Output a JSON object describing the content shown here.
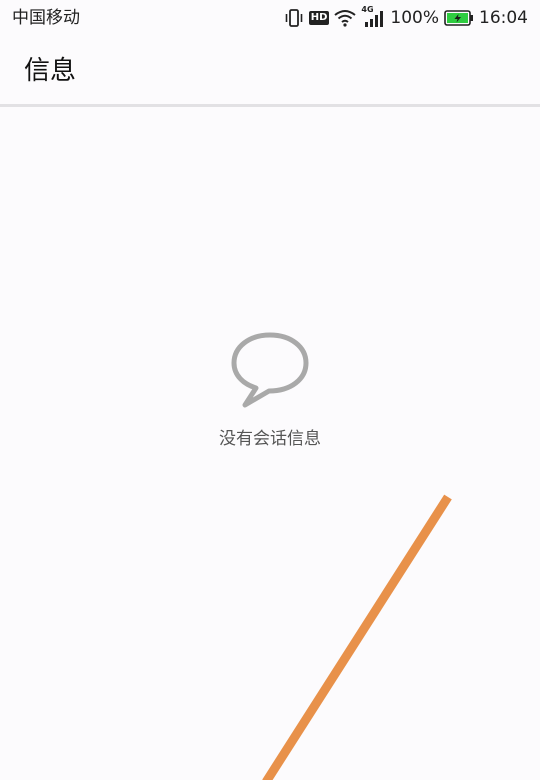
{
  "status_bar": {
    "carrier": "中国移动",
    "hd_label": "HD",
    "network_label": "4G",
    "battery_percent": "100%",
    "time": "16:04",
    "icons": [
      "vibrate-icon",
      "hd-icon",
      "wifi-icon",
      "signal-4g-icon",
      "battery-charging-icon"
    ],
    "battery_color": "#2ecc40"
  },
  "header": {
    "title": "信息"
  },
  "empty_state": {
    "icon": "chat-bubble-icon",
    "message": "没有会话信息",
    "icon_color": "#a9a9a9"
  },
  "overlay": {
    "line_color": "#e8914a"
  }
}
